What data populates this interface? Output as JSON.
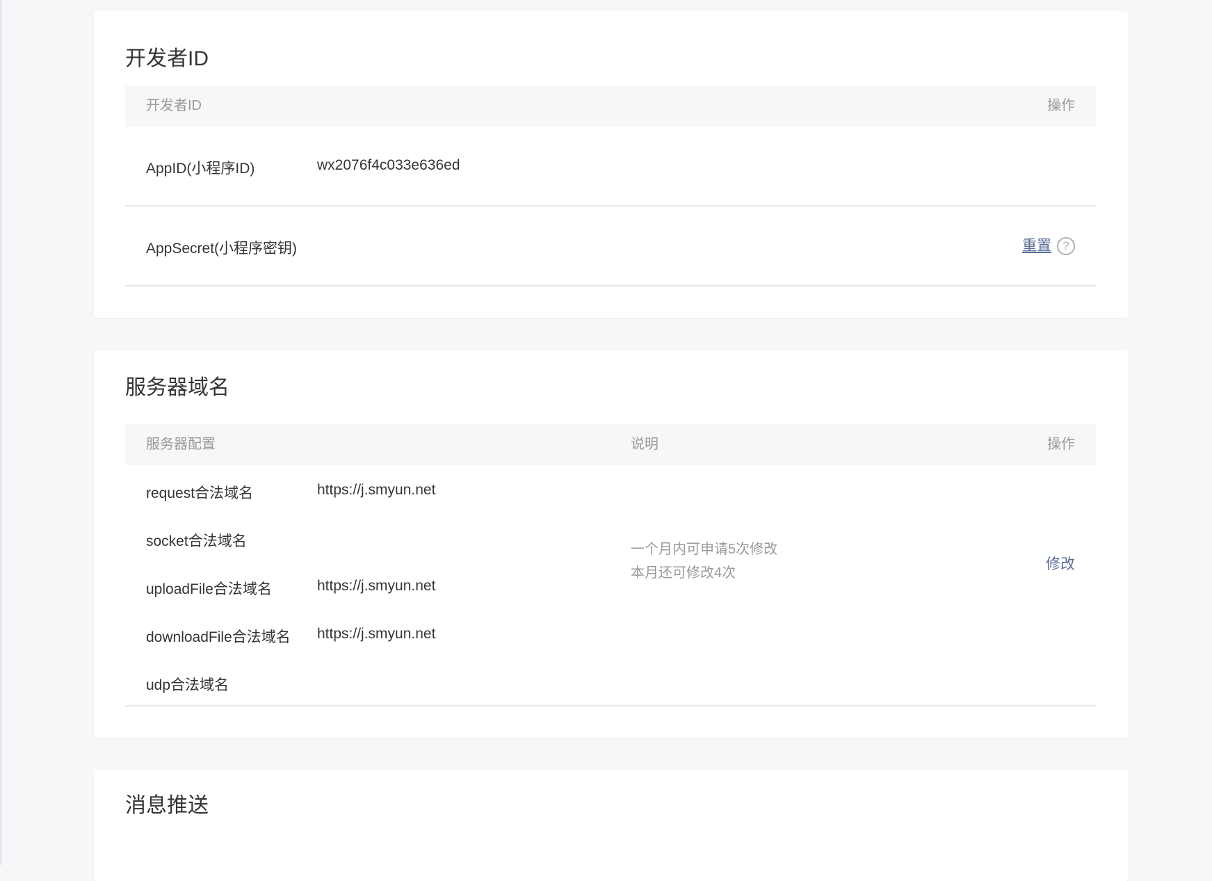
{
  "developer": {
    "title": "开发者ID",
    "header": {
      "col1": "开发者ID",
      "action": "操作"
    },
    "rows": [
      {
        "label": "AppID(小程序ID)",
        "value": "wx2076f4c033e636ed"
      },
      {
        "label": "AppSecret(小程序密钥)",
        "action": "重置",
        "help_icon": "?"
      }
    ]
  },
  "server": {
    "title": "服务器域名",
    "header": {
      "col1": "服务器配置",
      "col2": "说明",
      "action": "操作"
    },
    "rows": [
      {
        "label": "request合法域名",
        "value": "https://j.smyun.net"
      },
      {
        "label": "socket合法域名",
        "value": ""
      },
      {
        "label": "uploadFile合法域名",
        "value": "https://j.smyun.net"
      },
      {
        "label": "downloadFile合法域名",
        "value": "https://j.smyun.net"
      },
      {
        "label": "udp合法域名",
        "value": ""
      }
    ],
    "description": [
      "一个月内可申请5次修改",
      "本月还可修改4次"
    ],
    "action": "修改"
  },
  "push": {
    "title": "消息推送"
  },
  "colors": {
    "link": "#576b95",
    "background": "#f6f7f9"
  }
}
